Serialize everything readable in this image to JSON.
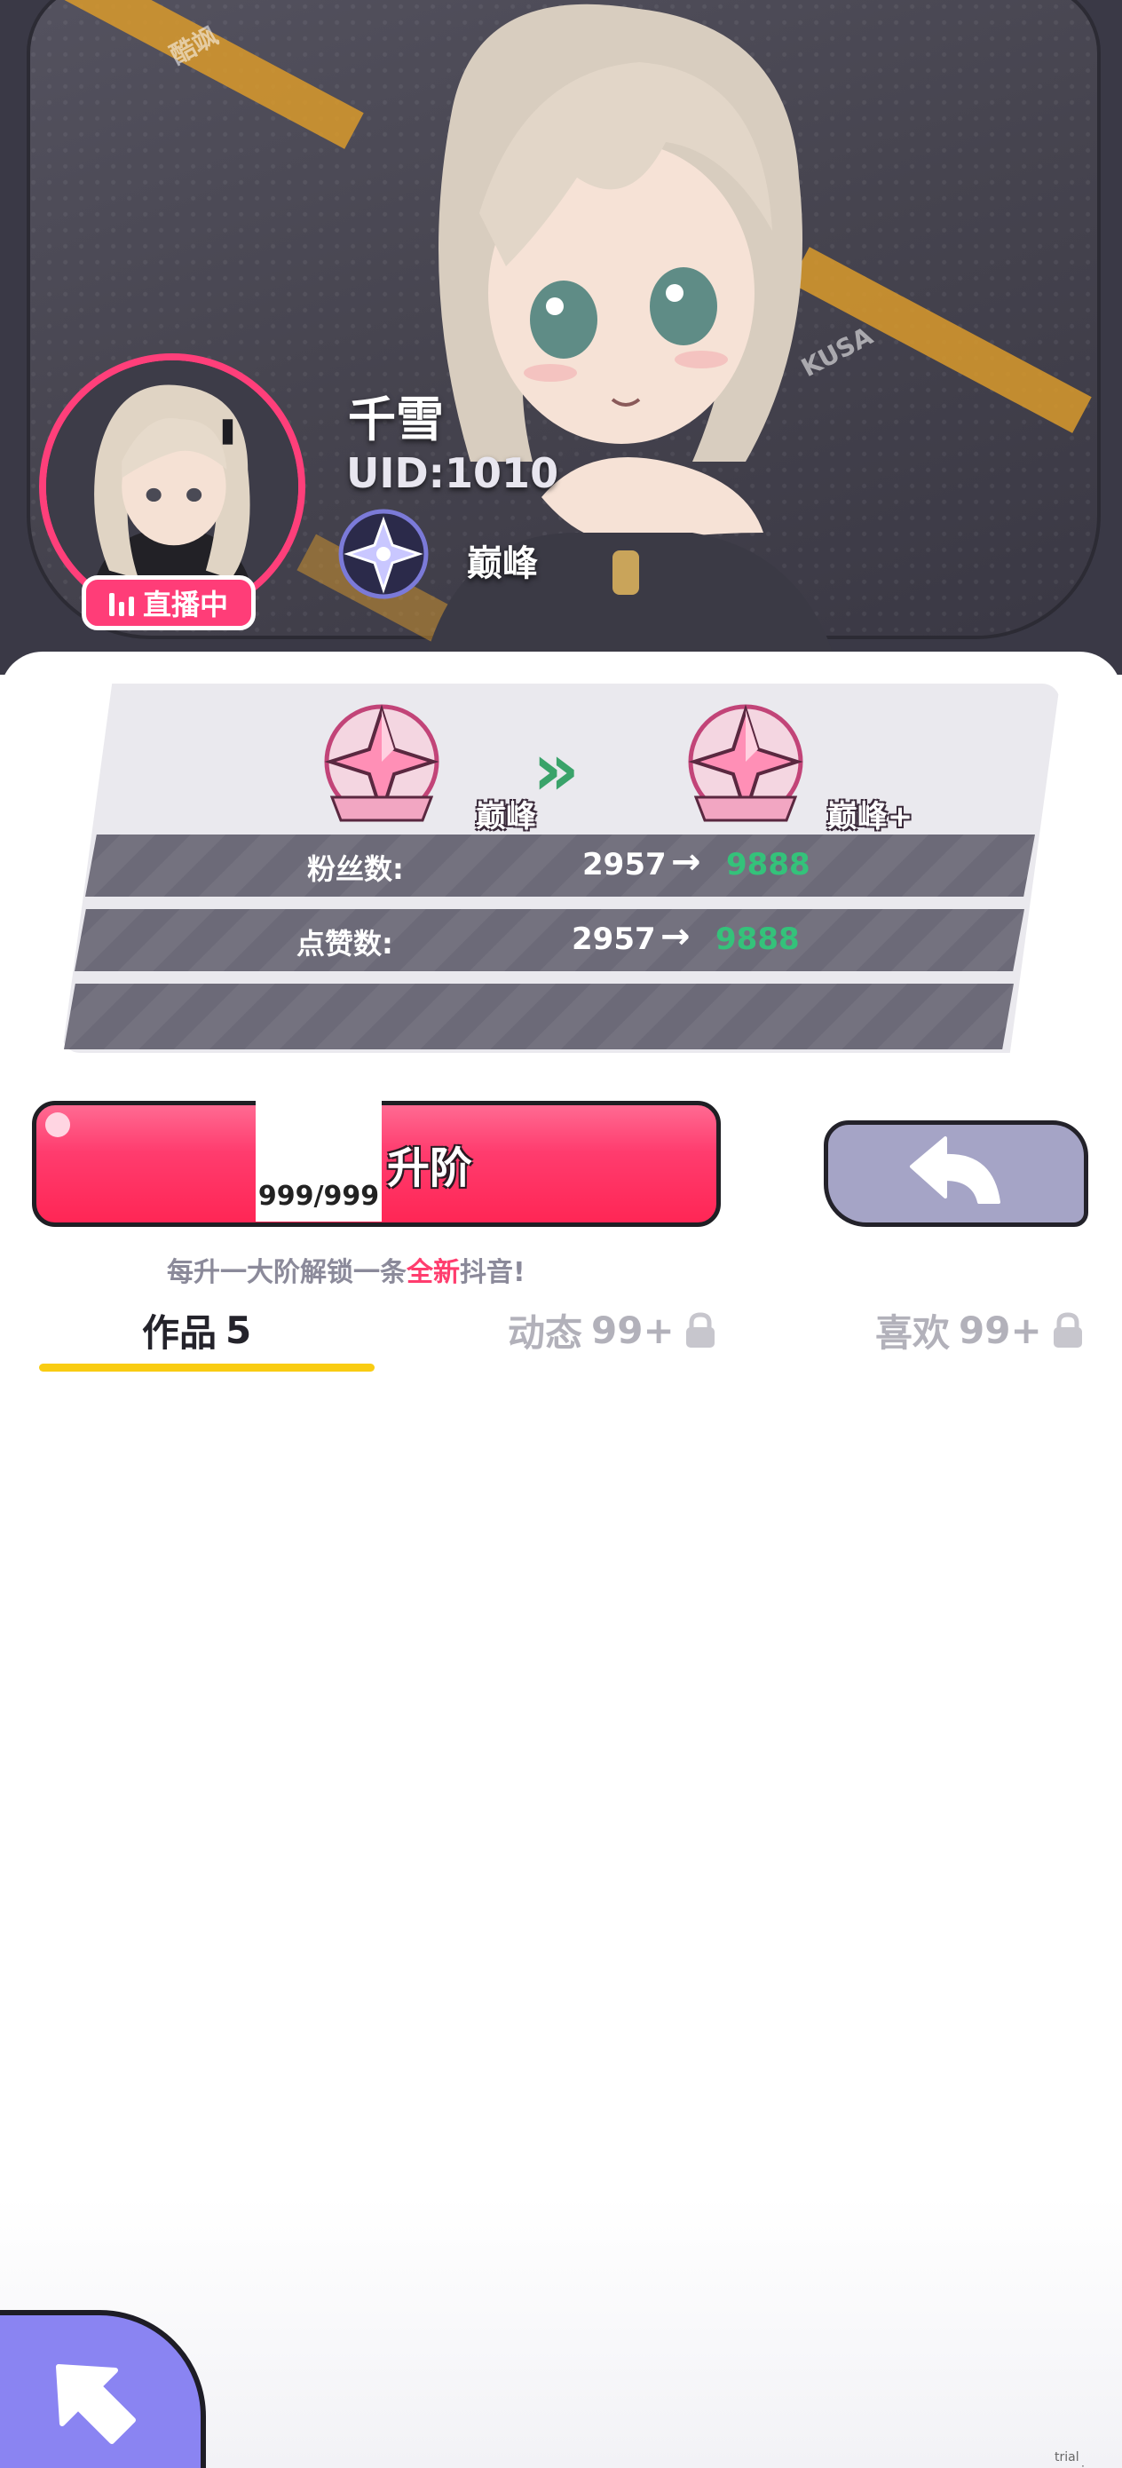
{
  "profile": {
    "name": "千雪",
    "uid": "UID:1010",
    "rank": "巅峰",
    "live_badge": "直播中"
  },
  "upgrade": {
    "current_rank": "巅峰",
    "next_rank": "巅峰+",
    "stats": [
      {
        "label": "粉丝数:",
        "from": "2957",
        "arrow": "→",
        "to": "9888"
      },
      {
        "label": "点赞数:",
        "from": "2957",
        "arrow": "→",
        "to": "9888"
      }
    ],
    "button_label": "升阶",
    "progress_text": "999/999",
    "hint_prefix": "每升一大阶解锁一条",
    "hint_highlight": "全新",
    "hint_suffix": "抖音!"
  },
  "tabs": [
    {
      "label": "作品",
      "count": "5",
      "locked": false,
      "active": true
    },
    {
      "label": "动态",
      "count": "99+",
      "locked": true,
      "active": false
    },
    {
      "label": "喜欢",
      "count": "99+",
      "locked": true,
      "active": false
    }
  ],
  "decor": {
    "stripe_text_1": "酷飒",
    "stripe_text_2": "KUSA"
  },
  "footer": {
    "watermark": "trial version"
  },
  "colors": {
    "accent_pink": "#ff3d78",
    "success_green": "#34c27a",
    "tab_underline": "#f9cc12",
    "back_button": "#a5a4c6",
    "corner_button": "#8a84f2"
  },
  "icons": [
    "live-bars-icon",
    "rank-star-icon",
    "double-chevron-icon",
    "back-arrow-icon",
    "lock-icon",
    "pointer-arrow-icon"
  ]
}
